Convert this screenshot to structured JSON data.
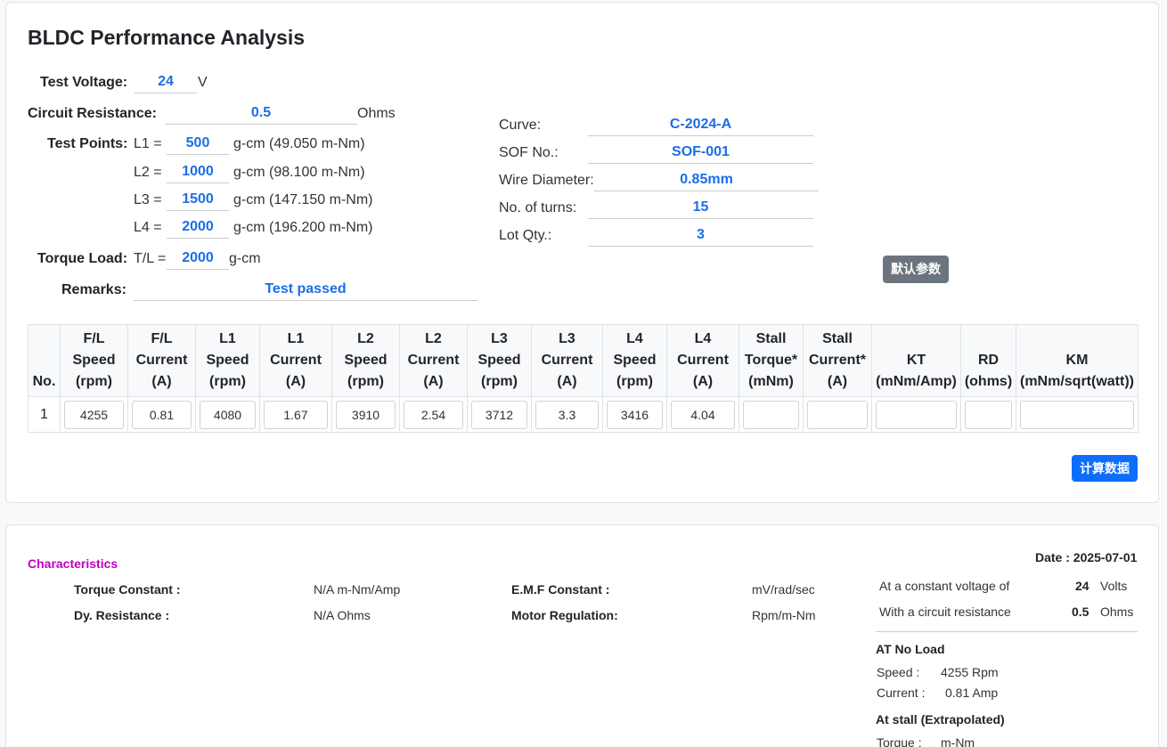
{
  "title": "BLDC Performance Analysis",
  "params": {
    "test_voltage": {
      "label": "Test Voltage:",
      "value": "24",
      "unit": "V"
    },
    "circuit_resistance": {
      "label": "Circuit Resistance:",
      "value": "0.5",
      "unit": "Ohms"
    },
    "test_points_label": "Test Points:",
    "test_points": [
      {
        "label": "L1 =",
        "value": "500",
        "unit": "g-cm (49.050 m-Nm)"
      },
      {
        "label": "L2 =",
        "value": "1000",
        "unit": "g-cm (98.100 m-Nm)"
      },
      {
        "label": "L3 =",
        "value": "1500",
        "unit": "g-cm (147.150 m-Nm)"
      },
      {
        "label": "L4 =",
        "value": "2000",
        "unit": "g-cm (196.200 m-Nm)"
      }
    ],
    "torque_load": {
      "label": "Torque Load:",
      "prefix": "T/L =",
      "value": "2000",
      "unit": "g-cm"
    },
    "remarks": {
      "label": "Remarks:",
      "value": "Test passed"
    }
  },
  "right_params": [
    {
      "label": "Curve:",
      "value": "C-2024-A"
    },
    {
      "label": "SOF No.:",
      "value": "SOF-001"
    },
    {
      "label": "Wire Diameter:",
      "value": "0.85mm"
    },
    {
      "label": "No. of turns:",
      "value": "15"
    },
    {
      "label": "Lot Qty.:",
      "value": "3"
    }
  ],
  "buttons": {
    "default_params": "默认参数",
    "calculate": "计算数据"
  },
  "table": {
    "headers": [
      [
        "No."
      ],
      [
        "F/L",
        "Speed",
        "(rpm)"
      ],
      [
        "F/L",
        "Current",
        "(A)"
      ],
      [
        "L1",
        "Speed",
        "(rpm)"
      ],
      [
        "L1",
        "Current",
        "(A)"
      ],
      [
        "L2",
        "Speed",
        "(rpm)"
      ],
      [
        "L2",
        "Current",
        "(A)"
      ],
      [
        "L3",
        "Speed",
        "(rpm)"
      ],
      [
        "L3",
        "Current",
        "(A)"
      ],
      [
        "L4",
        "Speed",
        "(rpm)"
      ],
      [
        "L4",
        "Current",
        "(A)"
      ],
      [
        "Stall",
        "Torque*",
        "(mNm)"
      ],
      [
        "Stall",
        "Current*",
        "(A)"
      ],
      [
        "KT",
        "(mNm/Amp)"
      ],
      [
        "RD",
        "(ohms)"
      ],
      [
        "KM",
        "(mNm/sqrt(watt))"
      ]
    ],
    "rows": [
      {
        "no": "1",
        "cells": [
          "4255",
          "0.81",
          "4080",
          "1.67",
          "3910",
          "2.54",
          "3712",
          "3.3",
          "3416",
          "4.04",
          "",
          "",
          "",
          "",
          ""
        ]
      }
    ]
  },
  "characteristics": {
    "title": "Characteristics",
    "date": "Date : 2025-07-01",
    "items": [
      {
        "label": "Torque Constant :",
        "value": "N/A m-Nm/Amp"
      },
      {
        "label": "E.M.F Constant :",
        "value": "mV/rad/sec"
      },
      {
        "label": "Dy. Resistance :",
        "value": "N/A Ohms"
      },
      {
        "label": "Motor Regulation:",
        "value": "Rpm/m-Nm"
      }
    ],
    "conditions": [
      {
        "label": "At a constant voltage of",
        "value": "24",
        "unit": "Volts"
      },
      {
        "label": "With a circuit resistance",
        "value": "0.5",
        "unit": "Ohms"
      }
    ],
    "no_load": {
      "title": "AT No Load",
      "items": [
        {
          "label": "Speed :",
          "value": "4255 Rpm"
        },
        {
          "label": "Current :",
          "value": "0.81 Amp"
        }
      ]
    },
    "stall": {
      "title": "At stall (Extrapolated)",
      "items": [
        {
          "label": "Torque :",
          "value": "m-Nm"
        }
      ]
    }
  }
}
